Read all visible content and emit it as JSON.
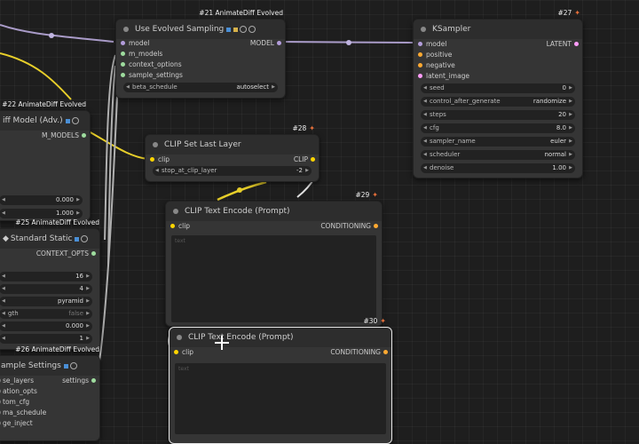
{
  "nodes": {
    "evolved_sampling": {
      "badge": "#21 AnimateDiff Evolved",
      "title": "Use Evolved Sampling",
      "inputs": [
        "model",
        "m_models",
        "context_options",
        "sample_settings"
      ],
      "output": "MODEL",
      "widget": {
        "label": "beta_schedule",
        "value": "autoselect"
      }
    },
    "ksampler": {
      "badge": "#27",
      "title": "KSampler",
      "inputs": [
        "model",
        "positive",
        "negative",
        "latent_image"
      ],
      "output": "LATENT",
      "widgets": [
        {
          "label": "seed",
          "value": "0"
        },
        {
          "label": "control_after_generate",
          "value": "randomize"
        },
        {
          "label": "steps",
          "value": "20"
        },
        {
          "label": "cfg",
          "value": "8.0"
        },
        {
          "label": "sampler_name",
          "value": "euler"
        },
        {
          "label": "scheduler",
          "value": "normal"
        },
        {
          "label": "denoise",
          "value": "1.00"
        }
      ]
    },
    "diff_model": {
      "badge": "#22 AnimateDiff Evolved",
      "title": "iff Model (Adv.)",
      "output": "M_MODELS",
      "values": [
        "0.000",
        "1.000"
      ]
    },
    "clip_last_layer": {
      "badge": "#28",
      "title": "CLIP Set Last Layer",
      "input": "clip",
      "output": "CLIP",
      "widget": {
        "label": "stop_at_clip_layer",
        "value": "-2"
      }
    },
    "context_static": {
      "badge": "#25 AnimateDiff Evolved",
      "title": "Standard Static",
      "output": "CONTEXT_OPTS",
      "rows": [
        {
          "label": "",
          "value": "16"
        },
        {
          "label": "",
          "value": "4"
        },
        {
          "label": "",
          "value": "pyramid"
        },
        {
          "label": "gth",
          "value": "false"
        },
        {
          "label": "",
          "value": "0.000"
        },
        {
          "label": "",
          "value": "1"
        }
      ]
    },
    "clip_text_29": {
      "badge": "#29",
      "title": "CLIP Text Encode (Prompt)",
      "input": "clip",
      "output": "CONDITIONING",
      "text": "text"
    },
    "clip_text_30": {
      "badge": "#30",
      "title": "CLIP Text Encode (Prompt)",
      "input": "clip",
      "output": "CONDITIONING",
      "text": "text"
    },
    "sample_settings": {
      "badge": "#26 AnimateDiff Evolved",
      "title": "ample Settings",
      "output": "settings",
      "inputs": [
        "se_layers",
        "ation_opts",
        "tom_cfg",
        "ma_schedule",
        "ge_inject"
      ]
    }
  },
  "colors": {
    "model": "#b39ddb",
    "clip": "#ffd500",
    "conditioning": "#ffa931",
    "latent": "#ff9cf9",
    "misc": "#9edc9e"
  }
}
